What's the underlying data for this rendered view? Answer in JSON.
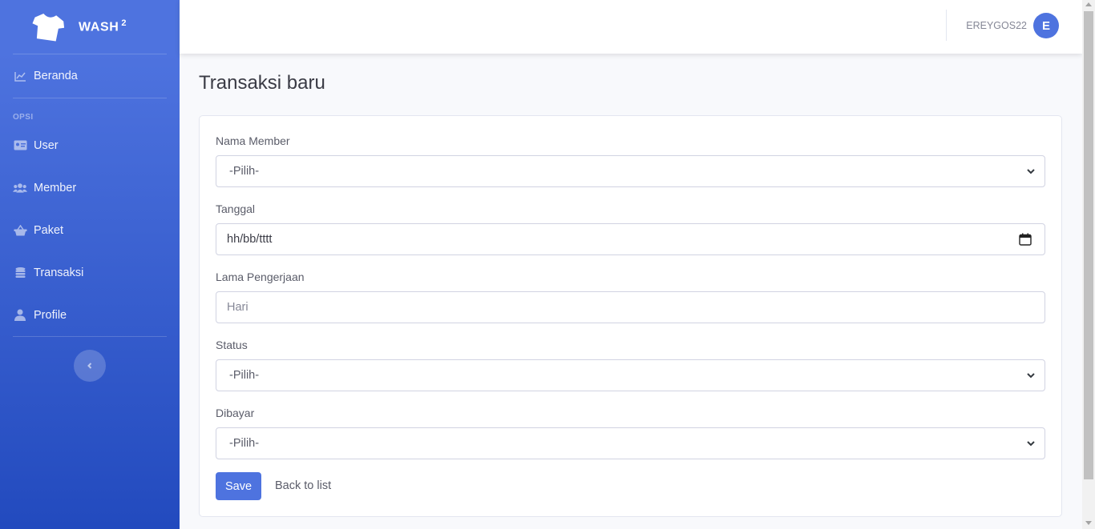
{
  "brand": {
    "name": "WASH",
    "sup": "2",
    "icon": "tshirt-icon"
  },
  "sidebar": {
    "items": [
      {
        "label": "Beranda",
        "icon": "chart-line-icon"
      }
    ],
    "heading": "OPSI",
    "opsi_items": [
      {
        "label": "User",
        "icon": "id-card-icon"
      },
      {
        "label": "Member",
        "icon": "users-icon"
      },
      {
        "label": "Paket",
        "icon": "basket-icon"
      },
      {
        "label": "Transaksi",
        "icon": "coins-icon"
      },
      {
        "label": "Profile",
        "icon": "user-icon"
      }
    ],
    "toggle_icon": "chevron-left-icon"
  },
  "topbar": {
    "username": "EREYGOS22",
    "avatar_letter": "E"
  },
  "page": {
    "title": "Transaksi baru"
  },
  "form": {
    "nama_member": {
      "label": "Nama Member",
      "value": "-Pilih-"
    },
    "tanggal": {
      "label": "Tanggal",
      "value": "hh/bb/tttt"
    },
    "lama": {
      "label": "Lama Pengerjaan",
      "placeholder": "Hari"
    },
    "status": {
      "label": "Status",
      "value": "-Pilih-"
    },
    "dibayar": {
      "label": "Dibayar",
      "value": "-Pilih-"
    },
    "save_label": "Save",
    "back_label": "Back to list"
  },
  "colors": {
    "primary": "#4e73df",
    "sidebar_end": "#224abe",
    "page_bg": "#f8f9fc"
  }
}
